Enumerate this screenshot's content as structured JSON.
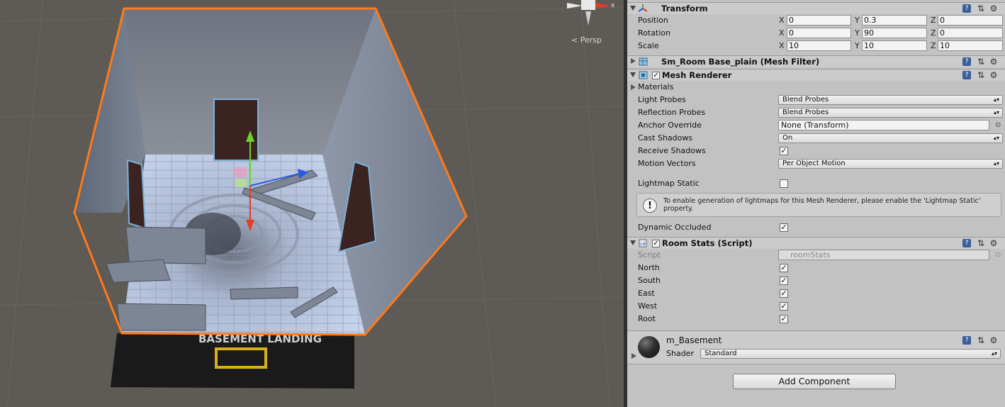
{
  "scene": {
    "persp_label": "Persp",
    "floor_sign": "BASEMENT LANDING"
  },
  "transform": {
    "title": "Transform",
    "rows": [
      {
        "label": "Position",
        "x": "0",
        "y": "0.3",
        "z": "0"
      },
      {
        "label": "Rotation",
        "x": "0",
        "y": "90",
        "z": "0"
      },
      {
        "label": "Scale",
        "x": "10",
        "y": "10",
        "z": "10"
      }
    ],
    "axis": {
      "x": "X",
      "y": "Y",
      "z": "Z"
    }
  },
  "mesh_filter": {
    "title": "Sm_Room Base_plain (Mesh Filter)"
  },
  "mesh_renderer": {
    "title": "Mesh Renderer",
    "materials_label": "Materials",
    "light_probes": {
      "label": "Light Probes",
      "value": "Blend Probes"
    },
    "reflection_probes": {
      "label": "Reflection Probes",
      "value": "Blend Probes"
    },
    "anchor_override": {
      "label": "Anchor Override",
      "value": "None (Transform)"
    },
    "cast_shadows": {
      "label": "Cast Shadows",
      "value": "On"
    },
    "receive_shadows": {
      "label": "Receive Shadows",
      "checked": true
    },
    "motion_vectors": {
      "label": "Motion Vectors",
      "value": "Per Object Motion"
    },
    "lightmap_static": {
      "label": "Lightmap Static",
      "checked": false
    },
    "help_text": "To enable generation of lightmaps for this Mesh Renderer, please enable the 'Lightmap Static' property.",
    "dynamic_occluded": {
      "label": "Dynamic Occluded",
      "checked": true
    }
  },
  "room_stats": {
    "title": "Room Stats (Script)",
    "script_label": "Script",
    "script_value": "roomStats",
    "fields": [
      {
        "label": "North",
        "checked": true
      },
      {
        "label": "South",
        "checked": true
      },
      {
        "label": "East",
        "checked": true
      },
      {
        "label": "West",
        "checked": true
      },
      {
        "label": "Root",
        "checked": true
      }
    ]
  },
  "material": {
    "name": "m_Basement",
    "shader_label": "Shader",
    "shader_value": "Standard"
  },
  "add_component": "Add Component",
  "colors": {
    "selection_outline": "#ff7a1a",
    "inspector_bg": "#c2c2c2",
    "help_blue": "#3b5f9a"
  }
}
